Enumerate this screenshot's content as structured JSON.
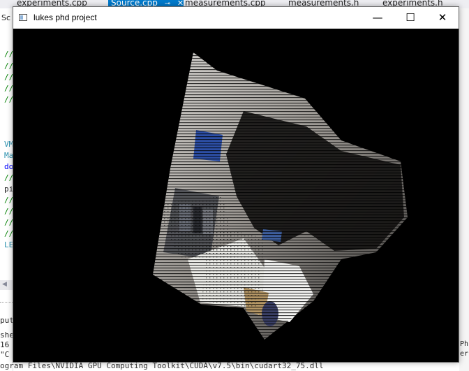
{
  "ide": {
    "tabs": [
      {
        "label": "experiments.cpp",
        "active": false
      },
      {
        "label": "Source.cpp",
        "active": true,
        "pin": "⊸",
        "close": "✕"
      },
      {
        "label": "measurements.cpp",
        "active": false
      },
      {
        "label": "measurements.h",
        "active": false
      },
      {
        "label": "experiments.h",
        "active": false
      }
    ],
    "left_label": "Sc",
    "code_fragments": [
      "//",
      "//",
      "//",
      "//",
      "//",
      "VM",
      "Ma",
      "do",
      "//",
      "pi",
      "//",
      "//",
      "//",
      "//",
      "LE"
    ],
    "output_fragments": [
      "put",
      "she",
      "16",
      "\"C",
      "ogram Files\\NVIDIA GPU Computing Toolkit\\CUDA\\v7.5\\bin\\cudart32_75.dll"
    ],
    "right_fragments": [
      "Ph",
      "er"
    ]
  },
  "window": {
    "title": "lukes phd project",
    "controls": {
      "minimize": "—",
      "maximize": "☐",
      "close": "✕"
    }
  },
  "colors": {
    "accent": "#007acc",
    "canvas_background": "#000000"
  }
}
